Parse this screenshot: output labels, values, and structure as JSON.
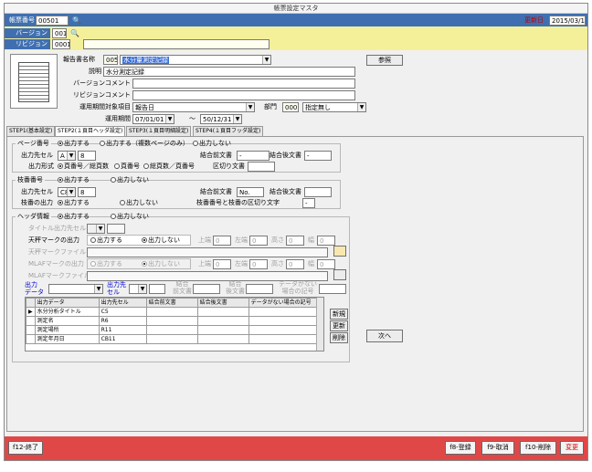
{
  "window": {
    "title": "帳票設定マスタ"
  },
  "header": {
    "form_no_label": "帳票番号",
    "form_no_value": "00501",
    "binoculars": "binoculars-icon",
    "update_label": "更新日",
    "update_value": "2015/03/19",
    "version_label": "バージョン",
    "version_value": "001",
    "revision_label": "リビジョン",
    "revision_value": "0001"
  },
  "info": {
    "report_name_label": "報告書名称",
    "report_code": "005",
    "report_name": "水分量測定記録",
    "ref_button": "参照",
    "desc_label": "説明",
    "desc_value": "水分測定記録",
    "version_comment_label": "バージョンコメント",
    "revision_comment_label": "リビジョンコメント",
    "period_item_label": "運用期間対象項目",
    "period_item_value": "報告日",
    "dept_label": "部門",
    "dept_code": "000",
    "dept_value": "指定無し",
    "period_label": "運用期間",
    "period_from": "07/01/01",
    "period_to": "50/12/31",
    "tilde": "～"
  },
  "tabs": [
    {
      "label": "STEP1(基本設定)"
    },
    {
      "label": "STEP2(１頁目ヘッダ設定)"
    },
    {
      "label": "STEP3(１頁目明細設定)"
    },
    {
      "label": "STEP4(１頁目フッダ設定)"
    }
  ],
  "page_no": {
    "title": "ページ番号",
    "opt1": "出力する",
    "opt2": "出力する（複数ページのみ）",
    "opt3": "出力しない",
    "cell_label": "出力先セル",
    "cell_col": "A",
    "cell_row": "8",
    "pre_label": "結合前文書",
    "pre_value": "-",
    "post_label": "結合後文書",
    "post_value": "-",
    "format_label": "出力形式",
    "fmt1": "頁番号／総頁数",
    "fmt2": "頁番号",
    "fmt3": "総頁数／頁番号",
    "sep_label": "区切り文書"
  },
  "branch": {
    "title": "枝番番号",
    "opt1": "出力する",
    "opt2": "出力しない",
    "cell_label": "出力先セル",
    "cell_col": "C8",
    "cell_row": "8",
    "pre_label": "結合前文書",
    "pre_value": "No.",
    "post_label": "結合後文書",
    "page_out_label": "枝番の出力",
    "po1": "出力する",
    "po2": "出力しない",
    "sep_label": "枝番番号と枝番の区切り文字",
    "sep_value": "-"
  },
  "header_info": {
    "title": "ヘッダ情報",
    "opt1": "出力する",
    "opt2": "出力しない",
    "title_cell_label": "タイトル出力先セル",
    "stamp_label": "天秤マークの出力",
    "stamp_on": "出力する",
    "stamp_off": "出力しない",
    "pos_top": "上端",
    "pos_left": "左端",
    "pos_h": "高さ",
    "pos_w": "幅",
    "pos_top_v": "0",
    "pos_left_v": "0",
    "pos_h_v": "0",
    "pos_w_v": "0",
    "stamp_file_label": "天秤マークファイル",
    "folder": "folder-icon",
    "mlaf_label": "MLAFマークの出力",
    "mlaf_on": "出力する",
    "mlaf_off": "出力しない",
    "mlaf_top_v": "0",
    "mlaf_left_v": "0",
    "mlaf_h_v": "0",
    "mlaf_w_v": "0",
    "mlaf_file_label": "MLAFマークファイル",
    "col_data": "出力データ",
    "col_cell": "出力先セル",
    "col_pre": "結合前文書",
    "col_post": "結合後文書",
    "col_empty": "データがない場合の記号",
    "input_pre": "結合",
    "input_pre2": "前文書",
    "input_post": "結合",
    "input_post2": "後文書",
    "input_empty": "データがない",
    "input_empty2": "場合の記号",
    "link_data": "出力",
    "link_data2": "データ",
    "link_cell": "出力先",
    "link_cell2": "セル",
    "rows": [
      {
        "data": "水分分析タイトル",
        "cell": "C5",
        "pre": "",
        "post": "",
        "empty": ""
      },
      {
        "data": "測定名",
        "cell": "R6",
        "pre": "",
        "post": "",
        "empty": ""
      },
      {
        "data": "測定場所",
        "cell": "R11",
        "pre": "",
        "post": "",
        "empty": ""
      },
      {
        "data": "測定年月日",
        "cell": "CB11",
        "pre": "",
        "post": "",
        "empty": ""
      }
    ],
    "btn_new": "新規",
    "btn_update": "更新",
    "btn_delete": "削除",
    "btn_next": "次へ"
  },
  "footer": {
    "f12": "f12-終了",
    "f8": "f8-登録",
    "f9": "f9-取消",
    "f10": "f10-削除",
    "copy": "変更"
  },
  "colors": {
    "accent": "#3f6fb0",
    "bottom": "#e04848",
    "header_row": "#f4f09a"
  }
}
